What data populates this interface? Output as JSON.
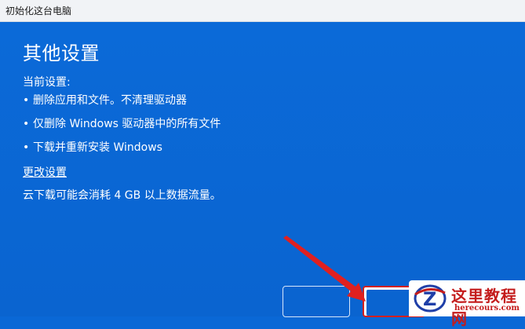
{
  "window": {
    "title": "初始化这台电脑"
  },
  "main": {
    "heading": "其他设置",
    "current_label": "当前设置:",
    "bullets": [
      "删除应用和文件。不清理驱动器",
      "仅删除 Windows 驱动器中的所有文件",
      "下载并重新安装 Windows"
    ],
    "change_settings_link": "更改设置",
    "data_note": "云下载可能会消耗 4 GB 以上数据流量。"
  },
  "watermark": {
    "title": "这里教程网",
    "url": "herecours.com"
  },
  "colors": {
    "background": "#0a68d6",
    "highlight": "#d21f1f",
    "watermark": "#c41c1c"
  },
  "bullet_symbol": "•"
}
